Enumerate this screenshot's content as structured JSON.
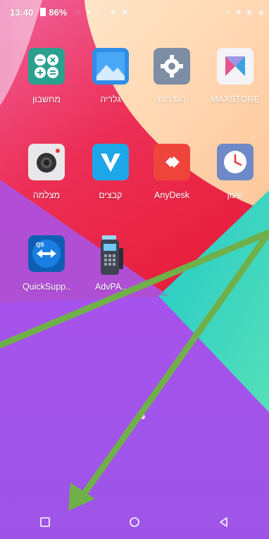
{
  "status_bar": {
    "time": "13:40",
    "battery": "86%"
  },
  "apps": [
    {
      "label": "מחשבון",
      "icon": "calculator-icon"
    },
    {
      "label": "גלריה",
      "icon": "gallery-icon"
    },
    {
      "label": "הגדרות",
      "icon": "settings-gear-icon"
    },
    {
      "label": "MAXSTORE",
      "icon": "maxstore-icon"
    },
    {
      "label": "מצלמה",
      "icon": "camera-icon"
    },
    {
      "label": "קבצים",
      "icon": "files-icon"
    },
    {
      "label": "AnyDesk",
      "icon": "anydesk-icon"
    },
    {
      "label": "שעון",
      "icon": "clock-icon"
    },
    {
      "label": "QuickSupp..",
      "icon": "quicksupport-icon"
    },
    {
      "label": "AdvPA..",
      "icon": "payment-terminal-icon"
    }
  ],
  "nav_bar": {
    "buttons": [
      "recent-apps",
      "home",
      "back"
    ]
  },
  "colors": {
    "annotation_arrow": "#6fb04a",
    "wallpaper_purple": "#a453ea",
    "wallpaper_red": "#ec2f57",
    "wallpaper_peach": "#ffd4ad",
    "wallpaper_teal": "#33d4c4"
  }
}
